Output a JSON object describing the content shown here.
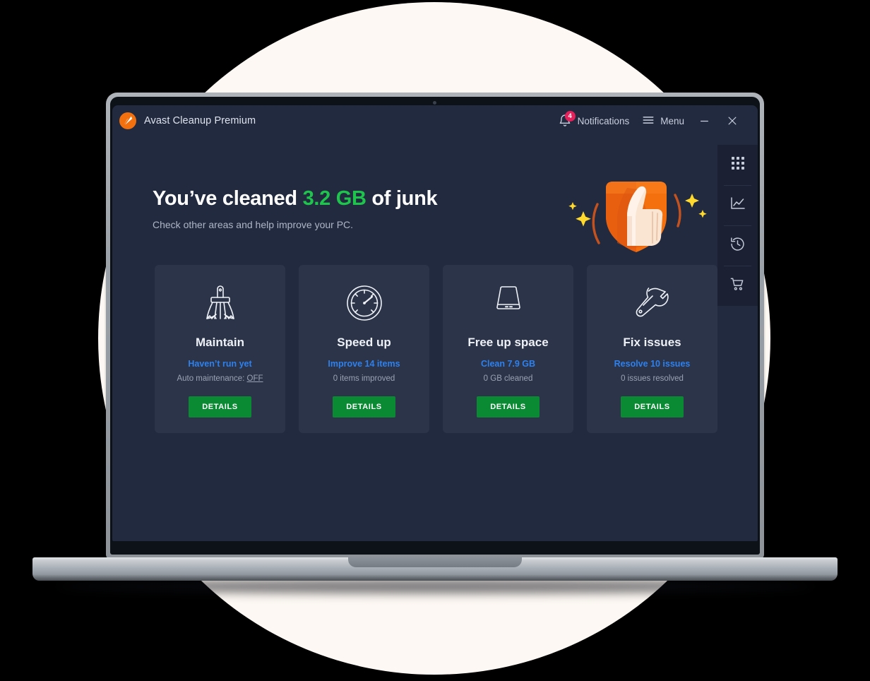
{
  "window": {
    "app_title": "Avast Cleanup Premium",
    "logo_icon": "avast-logo-icon"
  },
  "header": {
    "notifications": {
      "label": "Notifications",
      "icon": "bell-icon",
      "badge_count": "4",
      "badge_color": "#e3215b"
    },
    "menu": {
      "label": "Menu",
      "icon": "hamburger-icon"
    },
    "minimize": {
      "icon": "minimize-icon"
    },
    "close": {
      "icon": "close-icon"
    }
  },
  "rail": {
    "items": [
      {
        "icon": "grid-apps-icon",
        "active": true
      },
      {
        "icon": "performance-chart-icon",
        "active": false
      },
      {
        "icon": "history-clock-icon",
        "active": false
      },
      {
        "icon": "shopping-cart-icon",
        "active": false
      }
    ]
  },
  "hero": {
    "title_prefix": "You’ve cleaned ",
    "title_highlight": "3.2 GB",
    "title_suffix": " of junk",
    "subtitle": "Check other areas and help improve your PC.",
    "highlight_color": "#1ec44b",
    "illustration": "shield-thumbs-up-icon"
  },
  "cards": [
    {
      "icon": "broom-brush-icon",
      "title": "Maintain",
      "action": "Haven’t run yet",
      "sub_prefix": "Auto maintenance: ",
      "sub_underlined": "OFF",
      "button": "DETAILS"
    },
    {
      "icon": "speedometer-icon",
      "title": "Speed up",
      "action": "Improve 14 items",
      "sub_prefix": "0 items improved",
      "sub_underlined": "",
      "button": "DETAILS"
    },
    {
      "icon": "hard-drive-icon",
      "title": "Free up space",
      "action": "Clean 7.9 GB",
      "sub_prefix": "0 GB cleaned",
      "sub_underlined": "",
      "button": "DETAILS"
    },
    {
      "icon": "wrench-icon",
      "title": "Fix issues",
      "action": "Resolve 10 issues",
      "sub_prefix": "0 issues resolved",
      "sub_underlined": "",
      "button": "DETAILS"
    }
  ],
  "theme": {
    "app_bg": "#222a40",
    "card_bg": "#2c3449",
    "rail_bg": "#1b2133",
    "accent_blue": "#2e81ed",
    "accent_green": "#0a8a33",
    "backdrop": "#fdf8f3"
  }
}
